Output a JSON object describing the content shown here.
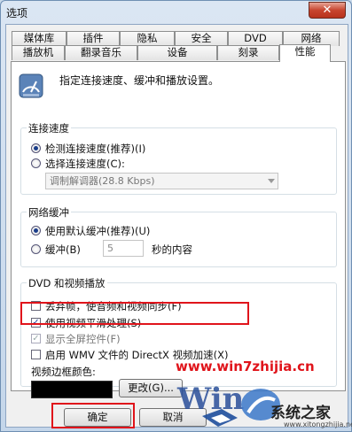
{
  "window": {
    "title": "选项",
    "close_glyph": "✕"
  },
  "tabs": {
    "row1": [
      "媒体库",
      "插件",
      "隐私",
      "安全",
      "DVD",
      "网络"
    ],
    "row2": [
      "播放机",
      "翻录音乐",
      "设备",
      "刻录",
      "性能"
    ],
    "active": "性能"
  },
  "intro_text": "指定连接速度、缓冲和播放设置。",
  "connection": {
    "legend": "连接速度",
    "detect_label": "检测连接速度(推荐)(I)",
    "choose_label": "选择连接速度(C):",
    "speed_value": "调制解调器(28.8 Kbps)",
    "selected": "detect"
  },
  "buffer": {
    "legend": "网络缓冲",
    "default_label": "使用默认缓冲(推荐)(U)",
    "custom_label": "缓冲(B)",
    "seconds_value": "5",
    "seconds_suffix": "秒的内容",
    "selected": "default"
  },
  "dvd_video": {
    "legend": "DVD 和视频播放",
    "drop_frames": {
      "label": "丢弃帧，使音频和视频同步(F)",
      "checked": false
    },
    "smoothing": {
      "label": "使用视频平滑处理(S)",
      "checked": true
    },
    "fullscreen_controls": {
      "label": "显示全屏控件(F)",
      "checked": true
    },
    "directx_accel": {
      "label": "启用 WMV 文件的 DirectX 视频加速(X)",
      "checked": false
    },
    "border_color_label": "视频边框颜色:",
    "border_color": "#000000",
    "change_button": "更改(G)..."
  },
  "footer": {
    "ok": "确定",
    "cancel": "取消"
  },
  "watermark": {
    "url": "www.win7zhijia.cn",
    "brand": "系统之家",
    "site": "www.xitongzhijia.net"
  },
  "colors": {
    "highlight": "#e0141b",
    "accent": "#1a3d8a"
  },
  "icons": {
    "performance": "performance-gauge-icon",
    "checkmark": "checkmark-icon"
  }
}
